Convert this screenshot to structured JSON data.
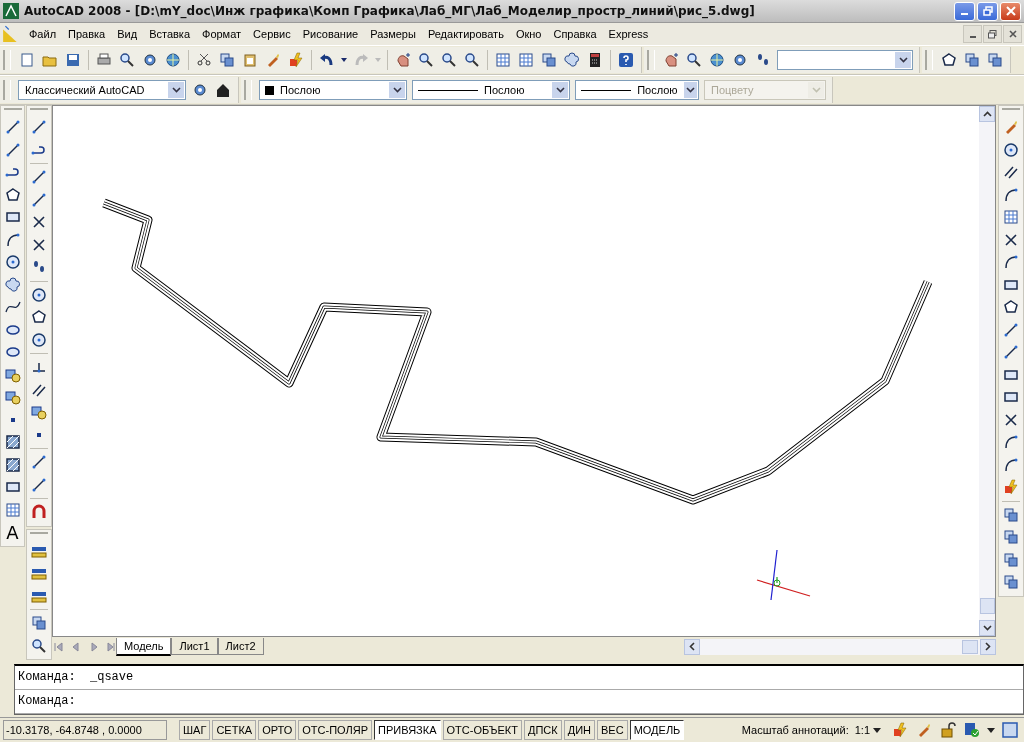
{
  "window": {
    "title": "AutoCAD 2008 - [D:\\mY_doc\\Инж графика\\Комп Графика\\Лаб_МГ\\Лаб_Моделир_простр_линий\\рис_5.dwg]"
  },
  "menu": {
    "items": [
      "Файл",
      "Правка",
      "Вид",
      "Вставка",
      "Формат",
      "Сервис",
      "Рисование",
      "Размеры",
      "Редактировать",
      "Окно",
      "Справка",
      "Express"
    ]
  },
  "properties_bar": {
    "workspace": "Классический AutoCAD",
    "layer_color": "Послою",
    "linetype": "Послою",
    "lineweight": "Послою",
    "plotstyle": {
      "value": "Поцвету",
      "disabled": true
    }
  },
  "draw_toolbar": {
    "text_tool_glyph": "A"
  },
  "layout_tabs": [
    {
      "label": "Модель",
      "selected": true
    },
    {
      "label": "Лист1",
      "selected": false
    },
    {
      "label": "Лист2",
      "selected": false
    }
  ],
  "command_line": {
    "history": "Команда:  _qsave",
    "prompt": "Команда:"
  },
  "status_bar": {
    "coordinates": "-10.3178, -64.8748 , 0.0000",
    "toggles": [
      {
        "label": "ШАГ",
        "on": false
      },
      {
        "label": "СЕТКА",
        "on": false
      },
      {
        "label": "ОРТО",
        "on": false
      },
      {
        "label": "ОТС-ПОЛЯР",
        "on": false
      },
      {
        "label": "ПРИВЯЗКА",
        "on": true
      },
      {
        "label": "ОТС-ОБЪЕКТ",
        "on": false
      },
      {
        "label": "ДПСК",
        "on": false
      },
      {
        "label": "ДИН",
        "on": false
      },
      {
        "label": "ВЕС",
        "on": false
      },
      {
        "label": "МОДЕЛЬ",
        "on": true
      }
    ],
    "annotation_scale_label": "Масштаб аннотаций:",
    "annotation_scale": "1:1"
  }
}
